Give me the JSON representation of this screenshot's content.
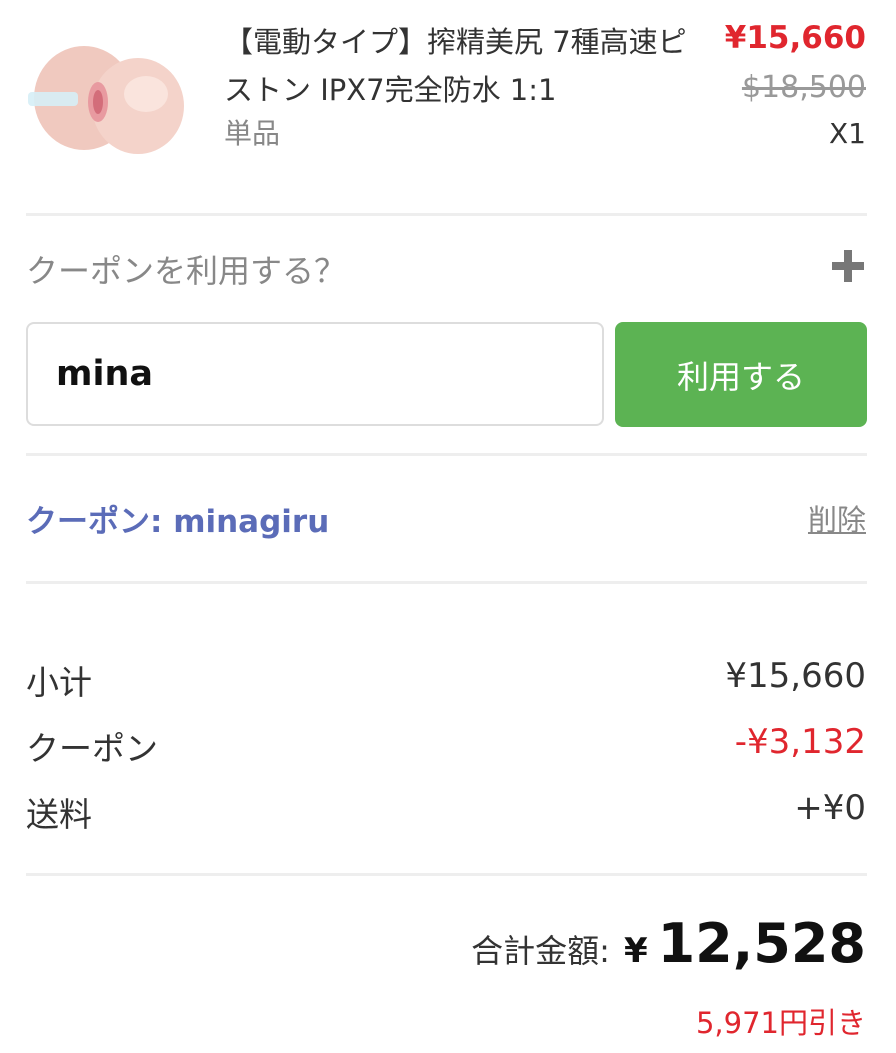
{
  "product": {
    "title": "【電動タイプ】搾精美尻 7種高速ピストン IPX7完全防水 1:1",
    "variant": "単品",
    "price": "¥15,660",
    "original_price": "$18,500",
    "quantity": "X1"
  },
  "coupon": {
    "toggle_label": "クーポンを利用する？",
    "input_value": "mina",
    "apply_label": "利用する",
    "applied_text": "クーポン: minagiru",
    "remove_label": "削除"
  },
  "summary": {
    "subtotal_label": "小计",
    "subtotal_value": "¥15,660",
    "coupon_label": "クーポン",
    "coupon_value": "-¥3,132",
    "shipping_label": "送料",
    "shipping_value": "+¥0",
    "total_label": "合計金額:",
    "total_currency": "¥",
    "total_value": "12,528",
    "savings_text": "5,971円引き"
  },
  "colors": {
    "accent_red": "#e0262e",
    "button_green": "#5cb353",
    "coupon_blue": "#5b6cb8"
  }
}
